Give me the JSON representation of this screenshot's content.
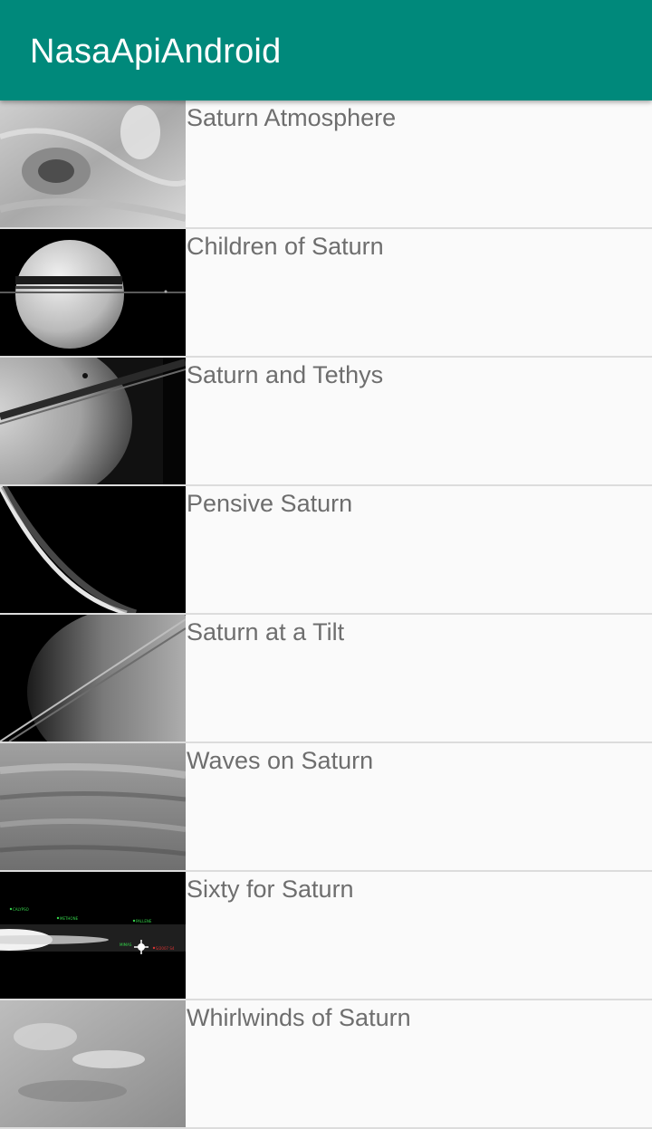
{
  "app": {
    "title": "NasaApiAndroid",
    "accent": "#00897b"
  },
  "items": [
    {
      "title": "Saturn Atmosphere",
      "image": "saturn-atmosphere-image"
    },
    {
      "title": "Children of Saturn",
      "image": "children-of-saturn-image"
    },
    {
      "title": "Saturn and Tethys",
      "image": "saturn-and-tethys-image"
    },
    {
      "title": "Pensive Saturn",
      "image": "pensive-saturn-image"
    },
    {
      "title": "Saturn at a Tilt",
      "image": "saturn-at-a-tilt-image"
    },
    {
      "title": "Waves on Saturn",
      "image": "waves-on-saturn-image"
    },
    {
      "title": "Sixty for Saturn",
      "image": "sixty-for-saturn-image",
      "image_labels": [
        "CALYPSO",
        "METHONE",
        "PALLENE",
        "MIMAS",
        "S/2007 S4"
      ]
    },
    {
      "title": "Whirlwinds of Saturn",
      "image": "whirlwinds-of-saturn-image"
    }
  ]
}
